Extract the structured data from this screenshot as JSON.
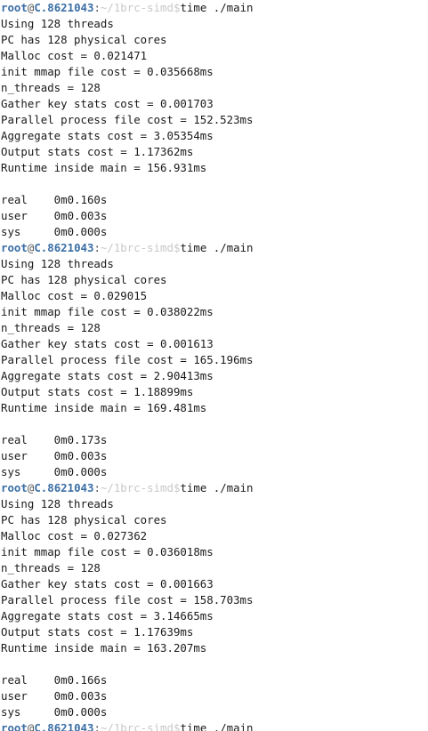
{
  "colors": {
    "background": "#ffffff",
    "text": "#1a1a1a",
    "prompt_user_host": "#3a6ea5",
    "prompt_path_faded": "#c8c8c8"
  },
  "prompt": {
    "user": "root",
    "at": "@",
    "host": "C.8621043",
    "colon": ":",
    "path": "~/1brc-simd",
    "dollar": "$"
  },
  "runs": [
    {
      "command": "time ./main",
      "output": [
        "Using 128 threads",
        "PC has 128 physical cores",
        "Malloc cost = 0.021471",
        "init mmap file cost = 0.035668ms",
        "n_threads = 128",
        "Gather key stats cost = 0.001703",
        "Parallel process file cost = 152.523ms",
        "Aggregate stats cost = 3.05354ms",
        "Output stats cost = 1.17362ms",
        "Runtime inside main = 156.931ms",
        "",
        "real\t0m0.160s",
        "user\t0m0.003s",
        "sys\t0m0.000s"
      ]
    },
    {
      "command": "time ./main",
      "output": [
        "Using 128 threads",
        "PC has 128 physical cores",
        "Malloc cost = 0.029015",
        "init mmap file cost = 0.038022ms",
        "n_threads = 128",
        "Gather key stats cost = 0.001613",
        "Parallel process file cost = 165.196ms",
        "Aggregate stats cost = 2.90413ms",
        "Output stats cost = 1.18899ms",
        "Runtime inside main = 169.481ms",
        "",
        "real\t0m0.173s",
        "user\t0m0.003s",
        "sys\t0m0.000s"
      ]
    },
    {
      "command": "time ./main",
      "output": [
        "Using 128 threads",
        "PC has 128 physical cores",
        "Malloc cost = 0.027362",
        "init mmap file cost = 0.036018ms",
        "n_threads = 128",
        "Gather key stats cost = 0.001663",
        "Parallel process file cost = 158.703ms",
        "Aggregate stats cost = 3.14665ms",
        "Output stats cost = 1.17639ms",
        "Runtime inside main = 163.207ms",
        "",
        "real\t0m0.166s",
        "user\t0m0.003s",
        "sys\t0m0.000s"
      ]
    }
  ],
  "final_prompt_command": "time ./main"
}
